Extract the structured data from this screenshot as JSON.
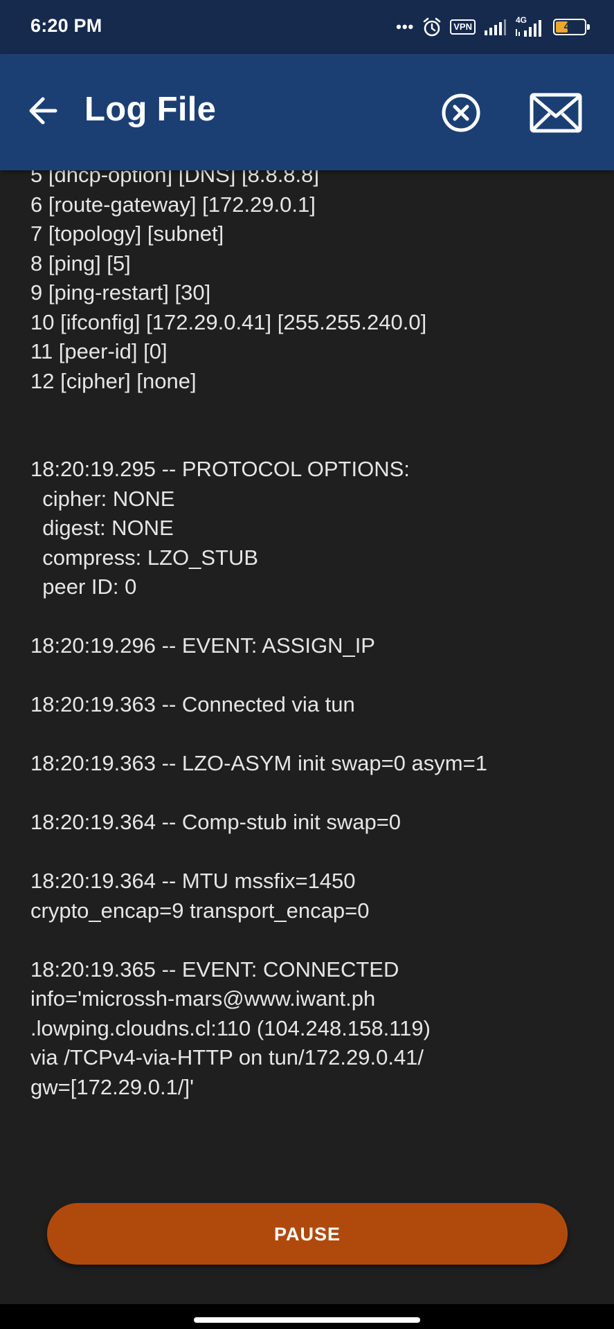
{
  "status_bar": {
    "time": "6:20 PM",
    "dots": "•••",
    "vpn": "VPN",
    "network": "4G",
    "battery": "48",
    "battery_level": 0.48
  },
  "app_bar": {
    "title": "Log File"
  },
  "log": {
    "text": "5 [dhcp-option] [DNS] [8.8.8.8]\n6 [route-gateway] [172.29.0.1]\n7 [topology] [subnet]\n8 [ping] [5]\n9 [ping-restart] [30]\n10 [ifconfig] [172.29.0.41] [255.255.240.0]\n11 [peer-id] [0]\n12 [cipher] [none]\n\n\n18:20:19.295 -- PROTOCOL OPTIONS:\n  cipher: NONE\n  digest: NONE\n  compress: LZO_STUB\n  peer ID: 0\n\n18:20:19.296 -- EVENT: ASSIGN_IP\n\n18:20:19.363 -- Connected via tun\n\n18:20:19.363 -- LZO-ASYM init swap=0 asym=1\n\n18:20:19.364 -- Comp-stub init swap=0\n\n18:20:19.364 -- MTU mssfix=1450\ncrypto_encap=9 transport_encap=0\n\n18:20:19.365 -- EVENT: CONNECTED\ninfo='microssh-mars@www.iwant.ph\n.lowping.cloudns.cl:110 (104.248.158.119)\nvia /TCPv4-via-HTTP on tun/172.29.0.41/\ngw=[172.29.0.1/]'"
  },
  "pause_button": {
    "label": "PAUSE"
  },
  "colors": {
    "status_bar": "#152a4d",
    "app_bar": "#1c3f73",
    "background": "#1f1f1f",
    "pause_button": "#b04a0c",
    "text": "#e6e6e6"
  }
}
